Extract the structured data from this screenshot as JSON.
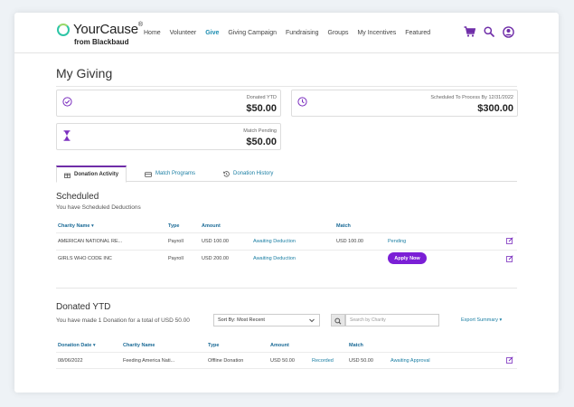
{
  "header": {
    "logo_main": "YourCause",
    "logo_reg": "®",
    "logo_sub": "from Blackbaud",
    "nav": [
      "Home",
      "Volunteer",
      "Give",
      "Giving Campaign",
      "Fundraising",
      "Groups",
      "My Incentives",
      "Featured"
    ],
    "active_nav": "Give",
    "icons": [
      "cart-icon",
      "search-icon",
      "user-icon"
    ],
    "accent": "#6f2da8"
  },
  "page": {
    "title": "My Giving"
  },
  "cards": {
    "donated_label": "Donated YTD",
    "donated_value": "$50.00",
    "scheduled_label": "Scheduled To Process By 12/31/2022",
    "scheduled_value": "$300.00",
    "match_label": "Match Pending",
    "match_value": "$50.00"
  },
  "tabs": {
    "donation_activity": "Donation Activity",
    "match_programs": "Match Programs",
    "donation_history": "Donation History"
  },
  "scheduled": {
    "title": "Scheduled",
    "subtitle": "You have Scheduled Deductions",
    "columns": {
      "charity": "Charity Name",
      "type": "Type",
      "amount": "Amount",
      "match": "Match"
    },
    "rows": [
      {
        "charity": "AMERICAN NATIONAL RE...",
        "type": "Payroll",
        "amount": "USD 100.00",
        "status": "Awaiting Deduction",
        "match": "USD 100.00",
        "match_status": "Pending"
      },
      {
        "charity": "GIRLS WHO CODE INC",
        "type": "Payroll",
        "amount": "USD 200.00",
        "status": "Awaiting Deduction",
        "action": "Apply Now"
      }
    ]
  },
  "donated": {
    "title": "Donated YTD",
    "subtitle": "You have made 1 Donation for a total of USD 50.00",
    "sort_label": "Sort By: Most Recent",
    "search_placeholder": "Search by Charity",
    "export": "Export Summary",
    "columns": {
      "date": "Donation Date",
      "charity": "Charity Name",
      "type": "Type",
      "amount": "Amount",
      "match": "Match"
    },
    "rows": [
      {
        "date": "08/06/2022",
        "charity": "Feeding America Nati...",
        "type": "Offline Donation",
        "amount": "USD 50.00",
        "status": "Recorded",
        "match": "USD 50.00",
        "match_status": "Awaiting Approval"
      }
    ]
  }
}
